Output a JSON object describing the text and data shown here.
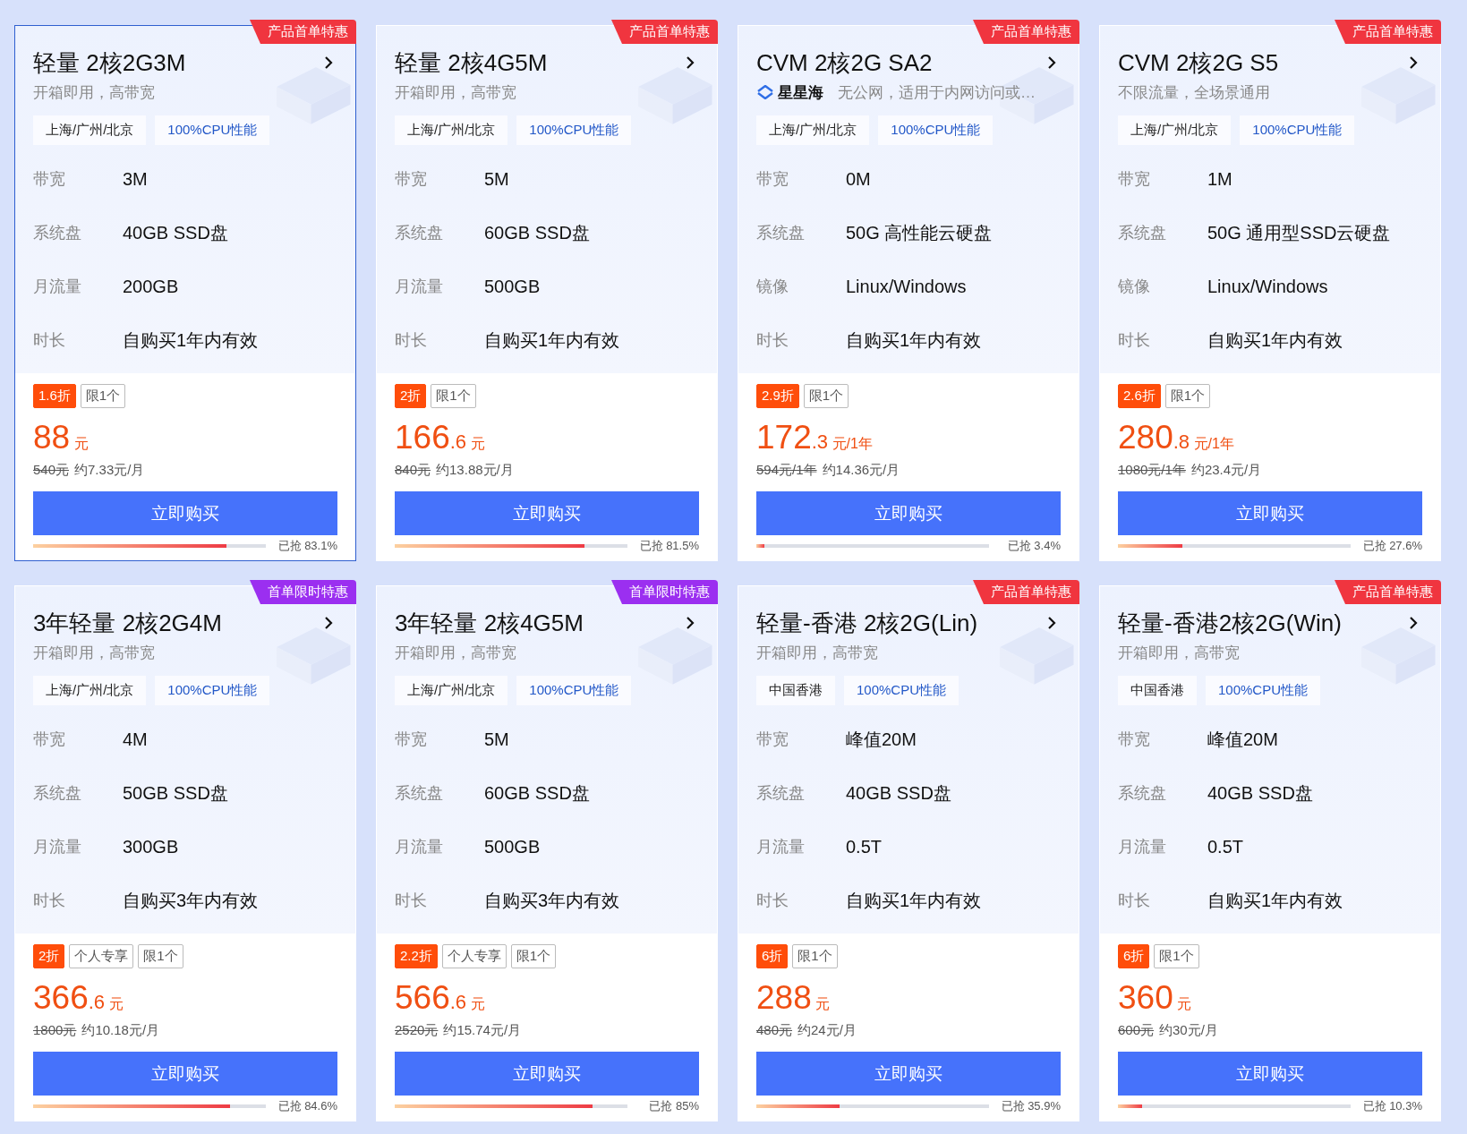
{
  "cards": [
    {
      "selected": true,
      "ribbon": {
        "text": "产品首单特惠",
        "color": "#f0353f"
      },
      "title": "轻量 2核2G3M",
      "subtitle": {
        "text": "开箱即用，高带宽"
      },
      "tags": [
        "上海/广州/北京",
        "100%CPU性能"
      ],
      "specs": [
        {
          "label": "带宽",
          "value": "3M"
        },
        {
          "label": "系统盘",
          "value": "40GB SSD盘"
        },
        {
          "label": "月流量",
          "value": "200GB"
        },
        {
          "label": "时长",
          "value": "自购买1年内有效"
        }
      ],
      "badges": [
        {
          "kind": "discount",
          "text": "1.6折"
        },
        {
          "kind": "plain",
          "text": "限1个"
        }
      ],
      "price": {
        "main": "88",
        "unit": "元"
      },
      "original_price": "540元",
      "monthly": "约7.33元/月",
      "button": "立即购买",
      "level": 0.831,
      "sold": "已抢 83.1%"
    },
    {
      "selected": false,
      "ribbon": {
        "text": "产品首单特惠",
        "color": "#f0353f"
      },
      "title": "轻量 2核4G5M",
      "subtitle": {
        "text": "开箱即用，高带宽"
      },
      "tags": [
        "上海/广州/北京",
        "100%CPU性能"
      ],
      "specs": [
        {
          "label": "带宽",
          "value": "5M"
        },
        {
          "label": "系统盘",
          "value": "60GB SSD盘"
        },
        {
          "label": "月流量",
          "value": "500GB"
        },
        {
          "label": "时长",
          "value": "自购买1年内有效"
        }
      ],
      "badges": [
        {
          "kind": "discount",
          "text": "2折"
        },
        {
          "kind": "plain",
          "text": "限1个"
        }
      ],
      "price": {
        "main": "166",
        "decimal": ".6",
        "unit": "元"
      },
      "original_price": "840元",
      "monthly": "约13.88元/月",
      "button": "立即购买",
      "level": 0.815,
      "sold": "已抢 81.5%"
    },
    {
      "selected": false,
      "ribbon": {
        "text": "产品首单特惠",
        "color": "#f0353f"
      },
      "title": "CVM 2核2G SA2",
      "subtitle": {
        "brand": "星星海",
        "text": "无公网，适用于内网访问或…"
      },
      "tags": [
        "上海/广州/北京",
        "100%CPU性能"
      ],
      "specs": [
        {
          "label": "带宽",
          "value": "0M"
        },
        {
          "label": "系统盘",
          "value": "50G 高性能云硬盘"
        },
        {
          "label": "镜像",
          "value": "Linux/Windows"
        },
        {
          "label": "时长",
          "value": "自购买1年内有效"
        }
      ],
      "badges": [
        {
          "kind": "discount",
          "text": "2.9折"
        },
        {
          "kind": "plain",
          "text": "限1个"
        }
      ],
      "price": {
        "main": "172",
        "decimal": ".3",
        "unit": "元/1年"
      },
      "original_price": "594元/1年",
      "monthly": "约14.36元/月",
      "button": "立即购买",
      "level": 0.034,
      "sold": "已抢 3.4%"
    },
    {
      "selected": false,
      "ribbon": {
        "text": "产品首单特惠",
        "color": "#f0353f"
      },
      "title": "CVM 2核2G S5",
      "subtitle": {
        "text": "不限流量，全场景通用"
      },
      "tags": [
        "上海/广州/北京",
        "100%CPU性能"
      ],
      "specs": [
        {
          "label": "带宽",
          "value": "1M"
        },
        {
          "label": "系统盘",
          "value": "50G 通用型SSD云硬盘"
        },
        {
          "label": "镜像",
          "value": "Linux/Windows"
        },
        {
          "label": "时长",
          "value": "自购买1年内有效"
        }
      ],
      "badges": [
        {
          "kind": "discount",
          "text": "2.6折"
        },
        {
          "kind": "plain",
          "text": "限1个"
        }
      ],
      "price": {
        "main": "280",
        "decimal": ".8",
        "unit": "元/1年"
      },
      "original_price": "1080元/1年",
      "monthly": "约23.4元/月",
      "button": "立即购买",
      "level": 0.276,
      "sold": "已抢 27.6%"
    },
    {
      "selected": false,
      "ribbon": {
        "text": "首单限时特惠",
        "color": "#9b2ff0"
      },
      "title": "3年轻量 2核2G4M",
      "subtitle": {
        "text": "开箱即用，高带宽"
      },
      "tags": [
        "上海/广州/北京",
        "100%CPU性能"
      ],
      "specs": [
        {
          "label": "带宽",
          "value": "4M"
        },
        {
          "label": "系统盘",
          "value": "50GB SSD盘"
        },
        {
          "label": "月流量",
          "value": "300GB"
        },
        {
          "label": "时长",
          "value": "自购买3年内有效"
        }
      ],
      "badges": [
        {
          "kind": "discount",
          "text": "2折"
        },
        {
          "kind": "plain",
          "text": "个人专享"
        },
        {
          "kind": "plain",
          "text": "限1个"
        }
      ],
      "price": {
        "main": "366",
        "decimal": ".6",
        "unit": "元"
      },
      "original_price": "1800元",
      "monthly": "约10.18元/月",
      "button": "立即购买",
      "level": 0.846,
      "sold": "已抢 84.6%"
    },
    {
      "selected": false,
      "ribbon": {
        "text": "首单限时特惠",
        "color": "#9b2ff0"
      },
      "title": "3年轻量 2核4G5M",
      "subtitle": {
        "text": "开箱即用，高带宽"
      },
      "tags": [
        "上海/广州/北京",
        "100%CPU性能"
      ],
      "specs": [
        {
          "label": "带宽",
          "value": "5M"
        },
        {
          "label": "系统盘",
          "value": "60GB SSD盘"
        },
        {
          "label": "月流量",
          "value": "500GB"
        },
        {
          "label": "时长",
          "value": "自购买3年内有效"
        }
      ],
      "badges": [
        {
          "kind": "discount",
          "text": "2.2折"
        },
        {
          "kind": "plain",
          "text": "个人专享"
        },
        {
          "kind": "plain",
          "text": "限1个"
        }
      ],
      "price": {
        "main": "566",
        "decimal": ".6",
        "unit": "元"
      },
      "original_price": "2520元",
      "monthly": "约15.74元/月",
      "button": "立即购买",
      "level": 0.85,
      "sold": "已抢 85%"
    },
    {
      "selected": false,
      "ribbon": {
        "text": "产品首单特惠",
        "color": "#f0353f"
      },
      "title": "轻量-香港 2核2G(Lin)",
      "subtitle": {
        "text": "开箱即用，高带宽"
      },
      "tags": [
        "中国香港",
        "100%CPU性能"
      ],
      "specs": [
        {
          "label": "带宽",
          "value": "峰值20M"
        },
        {
          "label": "系统盘",
          "value": "40GB SSD盘"
        },
        {
          "label": "月流量",
          "value": "0.5T"
        },
        {
          "label": "时长",
          "value": "自购买1年内有效"
        }
      ],
      "badges": [
        {
          "kind": "discount",
          "text": "6折"
        },
        {
          "kind": "plain",
          "text": "限1个"
        }
      ],
      "price": {
        "main": "288",
        "unit": "元"
      },
      "original_price": "480元",
      "monthly": "约24元/月",
      "button": "立即购买",
      "level": 0.359,
      "sold": "已抢 35.9%"
    },
    {
      "selected": false,
      "ribbon": {
        "text": "产品首单特惠",
        "color": "#f0353f"
      },
      "title": "轻量-香港2核2G(Win)",
      "subtitle": {
        "text": "开箱即用，高带宽"
      },
      "tags": [
        "中国香港",
        "100%CPU性能"
      ],
      "specs": [
        {
          "label": "带宽",
          "value": "峰值20M"
        },
        {
          "label": "系统盘",
          "value": "40GB SSD盘"
        },
        {
          "label": "月流量",
          "value": "0.5T"
        },
        {
          "label": "时长",
          "value": "自购买1年内有效"
        }
      ],
      "badges": [
        {
          "kind": "discount",
          "text": "6折"
        },
        {
          "kind": "plain",
          "text": "限1个"
        }
      ],
      "price": {
        "main": "360",
        "unit": "元"
      },
      "original_price": "600元",
      "monthly": "约30元/月",
      "button": "立即购买",
      "level": 0.103,
      "sold": "已抢 10.3%"
    }
  ]
}
